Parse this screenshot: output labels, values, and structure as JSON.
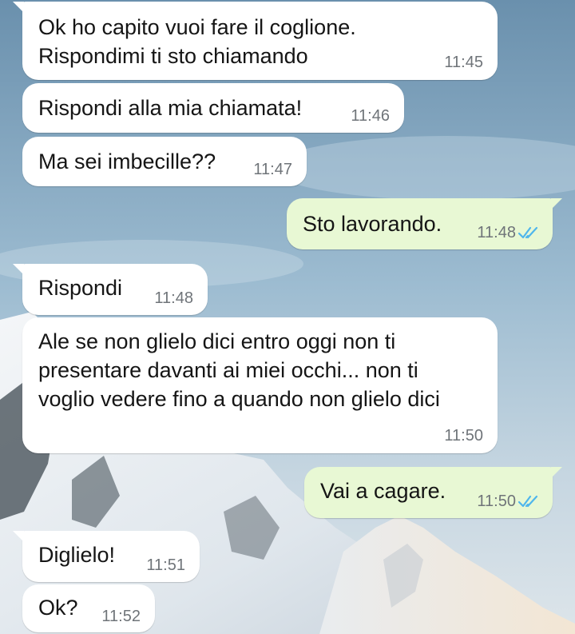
{
  "messages": [
    {
      "id": "m1",
      "dir": "in",
      "text": "Ok ho capito vuoi fare il coglione.\nRispondimi ti sto chiamando",
      "time": "11:45"
    },
    {
      "id": "m2",
      "dir": "in",
      "text": "Rispondi alla mia chiamata!",
      "time": "11:46"
    },
    {
      "id": "m3",
      "dir": "in",
      "text": "Ma sei imbecille??",
      "time": "11:47"
    },
    {
      "id": "m4",
      "dir": "out",
      "text": "Sto lavorando.",
      "time": "11:48",
      "status": "read"
    },
    {
      "id": "m5",
      "dir": "in",
      "text": "Rispondi",
      "time": "11:48"
    },
    {
      "id": "m6",
      "dir": "in",
      "text": "Ale se non glielo dici entro oggi non ti\npresentare davanti ai miei occhi... non ti\nvoglio vedere fino a quando non glielo dici",
      "time": "11:50"
    },
    {
      "id": "m7",
      "dir": "out",
      "text": "Vai a cagare.",
      "time": "11:50",
      "status": "read"
    },
    {
      "id": "m8",
      "dir": "in",
      "text": "Diglielo!",
      "time": "11:51"
    },
    {
      "id": "m9",
      "dir": "in",
      "text": "Ok?",
      "time": "11:52"
    }
  ],
  "colors": {
    "incoming_bubble": "#ffffff",
    "outgoing_bubble": "#e8f8d4",
    "read_ticks": "#4fb6ec",
    "timestamp": "#6f7479"
  },
  "icons": {
    "read_status": "double-check-icon"
  }
}
